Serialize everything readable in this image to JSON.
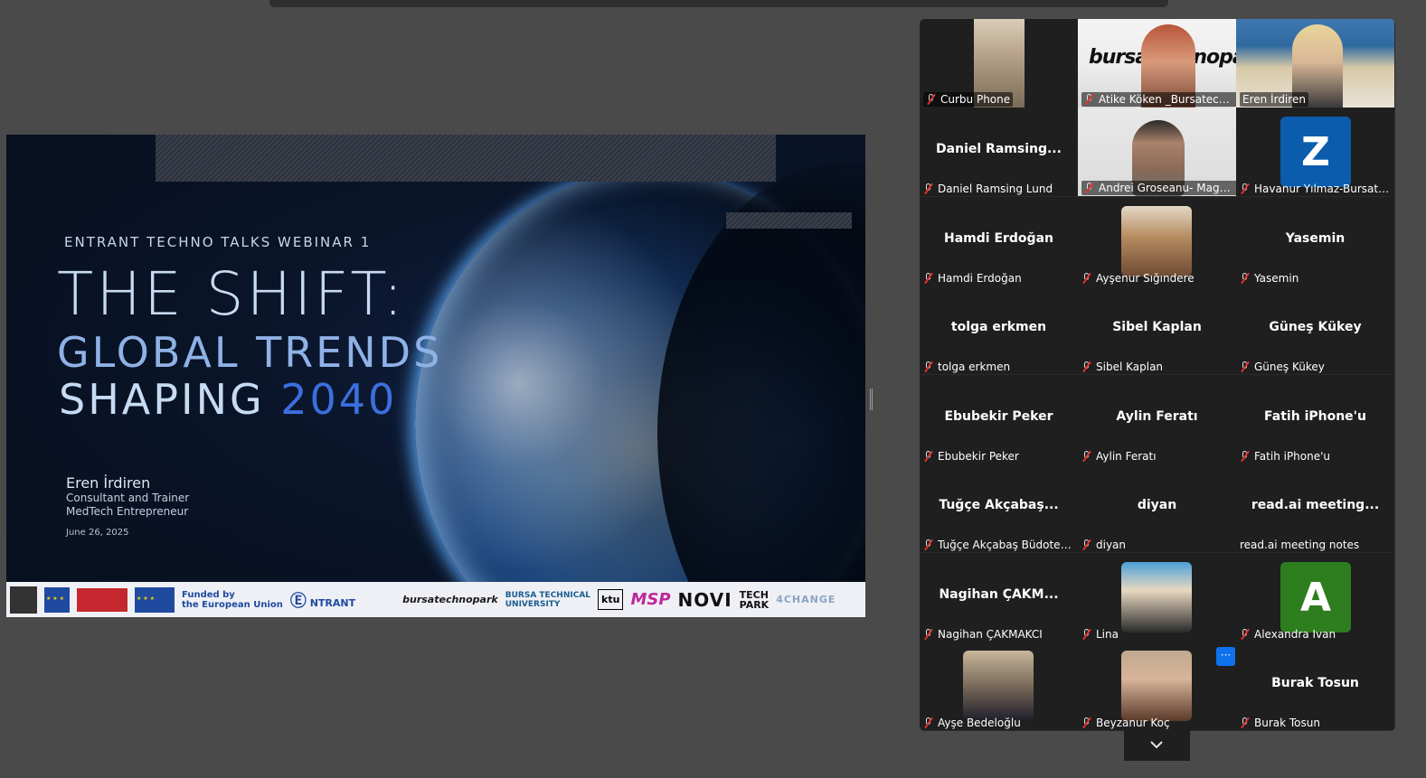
{
  "slide": {
    "kicker": "ENTRANT TECHNO TALKS WEBINAR 1",
    "title": "THE SHIFT:",
    "subtitle_line1": "GLOBAL TRENDS",
    "subtitle_line2": "SHAPING",
    "subtitle_year": "2040",
    "presenter_name": "Eren İrdiren",
    "presenter_role1": "Consultant  and Trainer",
    "presenter_role2": "MedTech Entrepreneur",
    "date": "June 26, 2025",
    "logos": {
      "funded_line1": "Funded by",
      "funded_line2": "the European Union",
      "entrant": "NTRANT",
      "bursatechnopark": "bursatechnopark",
      "btu_line1": "BURSA TECHNICAL",
      "btu_line2": "UNIVERSITY",
      "ktu": "ktu",
      "msp": "MSP",
      "novi": "NOVI",
      "techpark_line1": "TECH",
      "techpark_line2": "PARK",
      "consultancy": "4CHANGE"
    }
  },
  "participants": [
    {
      "label": "Curbu Phone",
      "display": "",
      "muted": true
    },
    {
      "label": "Atike Köken _Bursatechn...",
      "display": "",
      "muted": true
    },
    {
      "label": "Eren İrdiren",
      "display": "",
      "muted": false
    },
    {
      "label": "Daniel Ramsing Lund",
      "display": "Daniel  Ramsing...",
      "muted": true
    },
    {
      "label": "Andrei Groseanu- Magu...",
      "display": "",
      "muted": true
    },
    {
      "label": "Havanur Yılmaz-Bursate...",
      "display": "Z",
      "muted": true
    },
    {
      "label": "Hamdi Erdoğan",
      "display": "Hamdi Erdoğan",
      "muted": true
    },
    {
      "label": "Ayşenur Sığındere",
      "display": "",
      "muted": true
    },
    {
      "label": "Yasemin",
      "display": "Yasemin",
      "muted": true
    },
    {
      "label": "tolga erkmen",
      "display": "tolga erkmen",
      "muted": true
    },
    {
      "label": "Sibel Kaplan",
      "display": "Sibel Kaplan",
      "muted": true
    },
    {
      "label": "Güneş Kükey",
      "display": "Güneş Kükey",
      "muted": true
    },
    {
      "label": "Ebubekir Peker",
      "display": "Ebubekir Peker",
      "muted": true
    },
    {
      "label": "Aylin Feratı",
      "display": "Aylin Feratı",
      "muted": true
    },
    {
      "label": "Fatih iPhone'u",
      "display": "Fatih iPhone'u",
      "muted": true
    },
    {
      "label": "Tuğçe Akçabaş Büdotek ...",
      "display": "Tuğçe  Akçabaş...",
      "muted": true
    },
    {
      "label": "diyan",
      "display": "diyan",
      "muted": true
    },
    {
      "label": "read.ai meeting notes",
      "display": "read.ai  meeting...",
      "muted": false
    },
    {
      "label": "Nagihan ÇAKMAKCI",
      "display": "Nagihan  ÇAKM...",
      "muted": true
    },
    {
      "label": "Lina",
      "display": "",
      "muted": true
    },
    {
      "label": "Alexandra Ivan",
      "display": "A",
      "muted": true
    },
    {
      "label": "Ayşe Bedeloğlu",
      "display": "",
      "muted": true
    },
    {
      "label": "Beyzanur Koç",
      "display": "",
      "muted": true
    },
    {
      "label": "Burak Tosun",
      "display": "Burak Tosun",
      "muted": true
    }
  ],
  "controls": {
    "more_label": "···"
  },
  "colors": {
    "active_speaker": "#2fd37a",
    "avatar_z": "#0b5cad",
    "avatar_a": "#2e7d1f",
    "accent_blue": "#0e72ed"
  }
}
